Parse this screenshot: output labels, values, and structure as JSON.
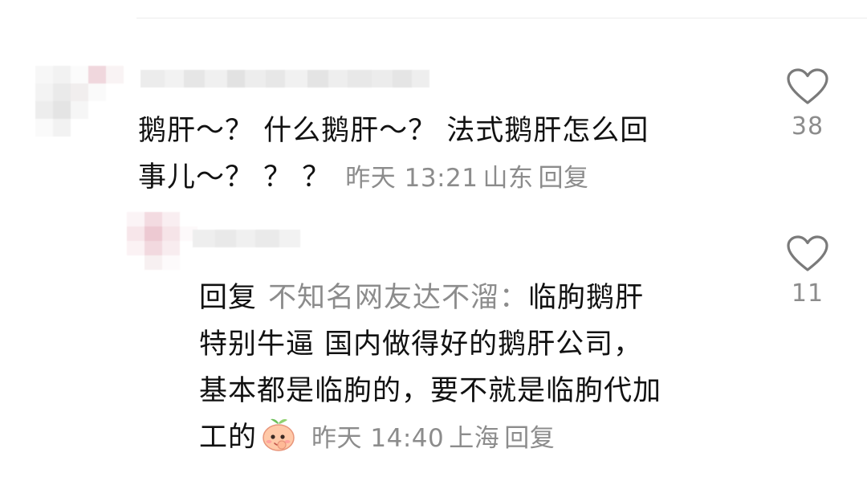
{
  "comments": [
    {
      "text_line1": "鹅肝～？ 什么鹅肝～？ 法式鹅肝怎么回",
      "text_line2": "事儿～？ ？ ？",
      "time": "昨天 13:21",
      "location": "山东",
      "reply_label": "回复",
      "likes": "38",
      "icon": "heart-outline-icon"
    },
    {
      "reply_prefix": "回复",
      "reply_target": "不知名网友达不溜：",
      "text_line1_tail": "临朐鹅肝",
      "text_line2": "特别牛逼  国内做得好的鹅肝公司，",
      "text_line3": "基本都是临朐的，要不就是临朐代加",
      "text_line4": "工的",
      "emoji": "peach-emoji-icon",
      "time": "昨天 14:40",
      "location": "上海",
      "reply_label": "回复",
      "likes": "11",
      "icon": "heart-outline-icon"
    }
  ],
  "colors": {
    "text": "#111111",
    "meta": "#8c8c8c",
    "heart_stroke": "#7a7a7a"
  }
}
